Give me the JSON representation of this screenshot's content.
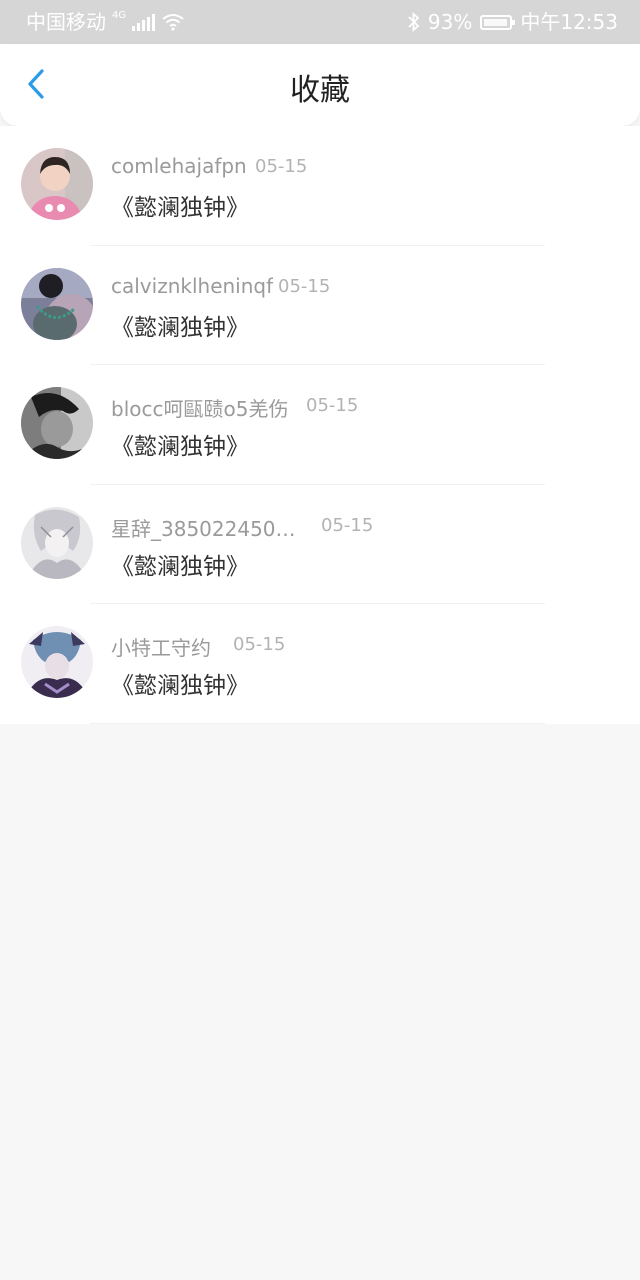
{
  "status_bar": {
    "carrier": "中国移动",
    "network_type": "4G",
    "battery_percent": "93%",
    "battery_level": 0.93,
    "time": "中午12:53"
  },
  "header": {
    "title": "收藏",
    "back_icon": "chevron-left-icon",
    "accent_color": "#2a9be8"
  },
  "favorites": [
    {
      "username": "comlehajafpn",
      "date": "05-15",
      "title": "《懿澜独钟》"
    },
    {
      "username": "calviznklheninqf",
      "date": "05-15",
      "title": "《懿澜独钟》"
    },
    {
      "username": "blocc呵甌赜o5羌伤",
      "date": "05-15",
      "title": "《懿澜独钟》"
    },
    {
      "username": "星辞_3850224503...",
      "date": "05-15",
      "title": "《懿澜独钟》"
    },
    {
      "username": "小特工守约",
      "date": "05-15",
      "title": "《懿澜独钟》"
    }
  ]
}
